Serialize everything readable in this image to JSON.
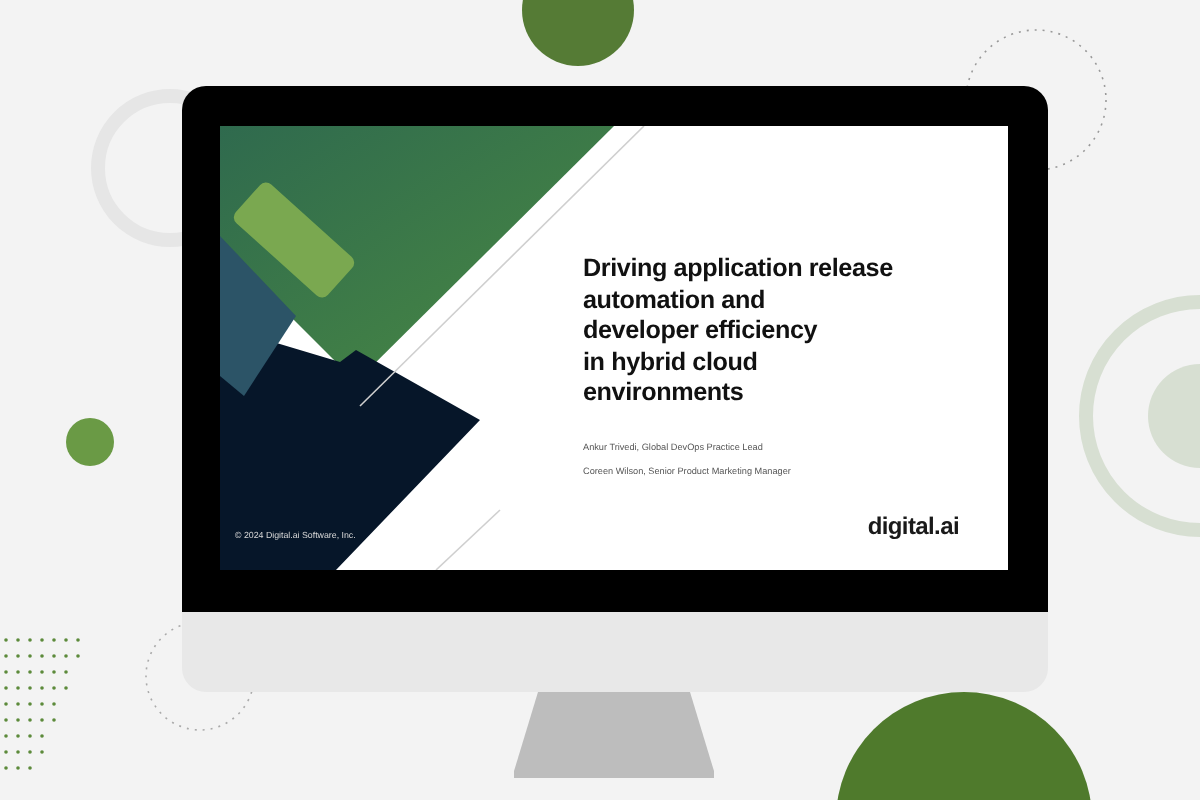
{
  "slide": {
    "title": "Driving application release\nautomation and\ndeveloper efficiency\nin hybrid cloud\nenvironments",
    "authors": [
      "Ankur Trivedi, Global DevOps Practice Lead",
      "Coreen Wilson, Senior Product Marketing Manager"
    ],
    "copyright": "© 2024 Digital.ai Software, Inc.",
    "logo": "digital.ai"
  }
}
